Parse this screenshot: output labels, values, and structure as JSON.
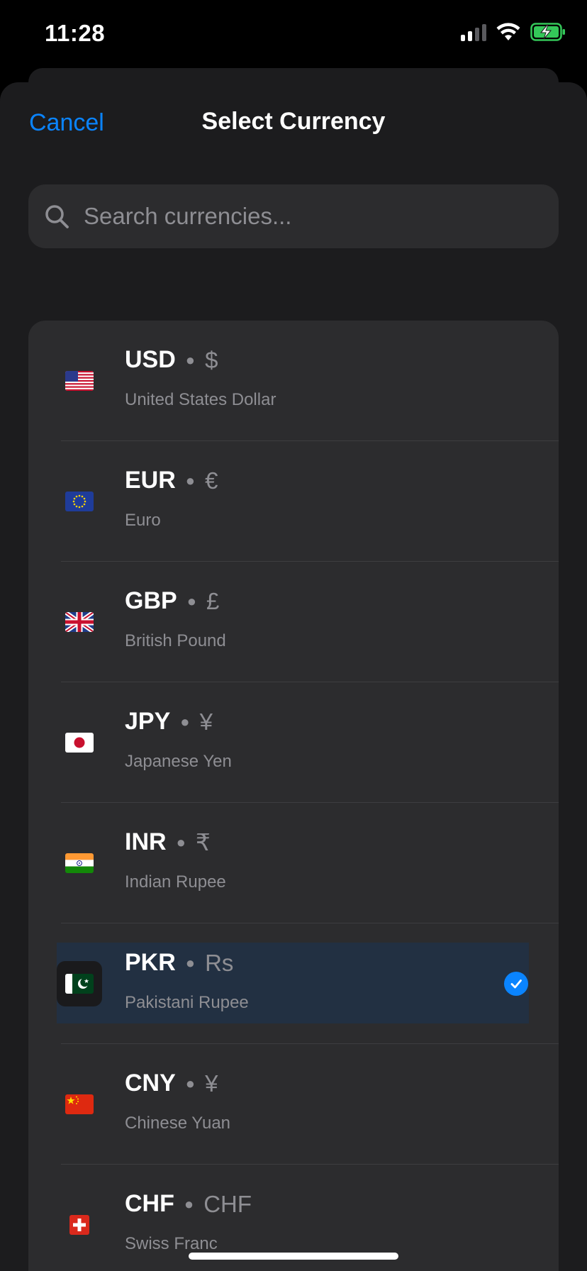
{
  "status_bar": {
    "time": "11:28",
    "icons": [
      "cellular-signal-icon",
      "wifi-icon",
      "battery-charging-icon"
    ]
  },
  "header": {
    "cancel_label": "Cancel",
    "title": "Select Currency"
  },
  "search": {
    "placeholder": "Search currencies...",
    "value": ""
  },
  "colors": {
    "accent": "#0a84ff",
    "sheet_bg": "#1c1c1e",
    "card_bg": "#2c2c2e",
    "selected_row_bg": "#223042"
  },
  "currencies": [
    {
      "code": "USD",
      "symbol": "$",
      "name": "United States Dollar",
      "flag": "us-flag-icon",
      "selected": false
    },
    {
      "code": "EUR",
      "symbol": "€",
      "name": "Euro",
      "flag": "eu-flag-icon",
      "selected": false
    },
    {
      "code": "GBP",
      "symbol": "£",
      "name": "British Pound",
      "flag": "uk-flag-icon",
      "selected": false
    },
    {
      "code": "JPY",
      "symbol": "¥",
      "name": "Japanese Yen",
      "flag": "japan-flag-icon",
      "selected": false
    },
    {
      "code": "INR",
      "symbol": "₹",
      "name": "Indian Rupee",
      "flag": "india-flag-icon",
      "selected": false
    },
    {
      "code": "PKR",
      "symbol": "Rs",
      "name": "Pakistani Rupee",
      "flag": "pakistan-flag-icon",
      "selected": true
    },
    {
      "code": "CNY",
      "symbol": "¥",
      "name": "Chinese Yuan",
      "flag": "china-flag-icon",
      "selected": false
    },
    {
      "code": "CHF",
      "symbol": "CHF",
      "name": "Swiss Franc",
      "flag": "switzerland-flag-icon",
      "selected": false
    }
  ]
}
